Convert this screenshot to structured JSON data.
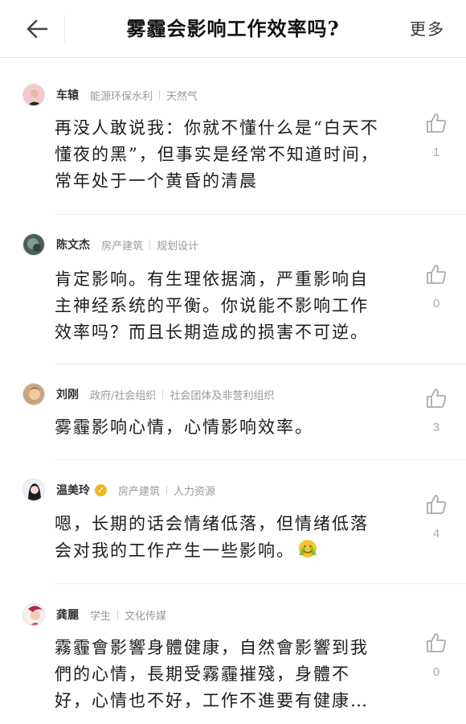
{
  "header": {
    "title": "雾霾会影响工作效率吗?",
    "more_label": "更多"
  },
  "answers": [
    {
      "user": "车辕",
      "tag1": "能源环保水利",
      "tag2": "天然气",
      "verified": false,
      "text": "再没人敢说我：你就不懂什么是“白天不懂夜的黑”，但事实是经常不知道时间，常年处于一个黄昏的清晨",
      "likes": "1"
    },
    {
      "user": "陈文杰",
      "tag1": "房产建筑",
      "tag2": "规划设计",
      "verified": false,
      "text": "肯定影响。有生理依据滴，严重影响自主神经系统的平衡。你说能不影响工作效率吗？而且长期造成的损害不可逆。",
      "likes": "0"
    },
    {
      "user": "刘刚",
      "tag1": "政府/社会组织",
      "tag2": "社会团体及非营利组织",
      "verified": false,
      "text": "雾霾影响心情，心情影响效率。",
      "likes": "3"
    },
    {
      "user": "温美玲",
      "tag1": "房产建筑",
      "tag2": "人力资源",
      "verified": true,
      "text": "嗯，长期的话会情绪低落，但情绪低落会对我的工作产生一些影响。",
      "likes": "4"
    },
    {
      "user": "龚麗",
      "tag1": "学生",
      "tag2": "文化传媒",
      "verified": false,
      "text": "霧霾會影響身體健康，自然會影響到我們的心情，長期受霧霾摧殘，身體不好，心情也不好，工作不進要有健康…",
      "likes": "0"
    }
  ],
  "colors": {
    "text": "#1c1c1c",
    "meta": "#999999",
    "badge": "#f1b521",
    "divider": "#ececec"
  },
  "icons": [
    "back-arrow-icon",
    "thumbs-up-icon",
    "verified-badge-icon",
    "facepalm-emoji-icon"
  ]
}
